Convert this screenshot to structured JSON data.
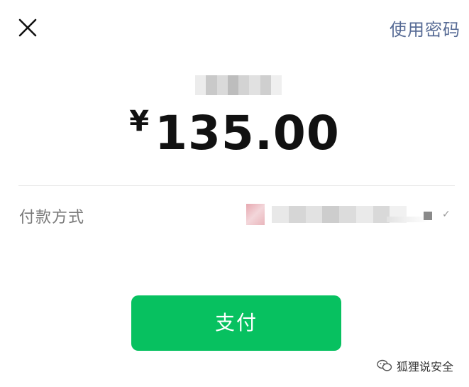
{
  "header": {
    "close_icon": "close-icon",
    "use_password_label": "使用密码"
  },
  "payment": {
    "payee_name_blurred": "",
    "currency_symbol": "¥",
    "amount": "135.00"
  },
  "method": {
    "label": "付款方式",
    "card_name_blurred": "",
    "selected_icon": "check-icon"
  },
  "actions": {
    "pay_label": "支付"
  },
  "watermark": {
    "text": "狐狸说安全",
    "logo_icon": "wechat-logo-icon"
  },
  "colors": {
    "accent": "#07c160",
    "link": "#576b95",
    "text_primary": "#111111",
    "text_secondary": "#7a7a7a"
  }
}
